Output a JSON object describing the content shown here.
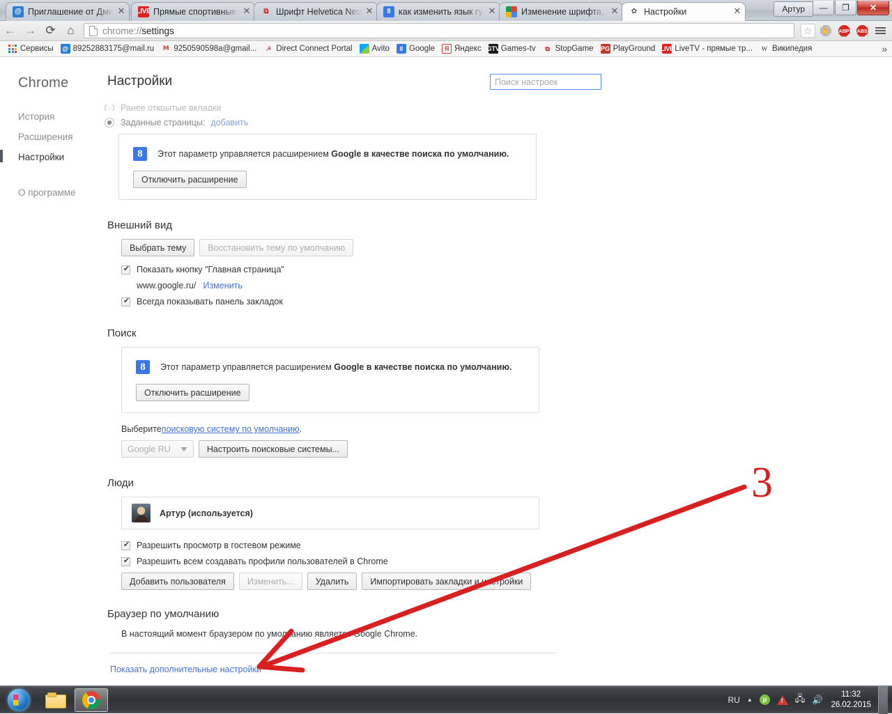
{
  "window": {
    "user_badge": "Артур",
    "controls": {
      "minimize": "—",
      "maximize": "❐",
      "close": "✕"
    }
  },
  "tabs": [
    {
      "title": "Приглашение от Дми",
      "icon": "mailru-icon",
      "close": "✕",
      "active": false
    },
    {
      "title": "Прямые спортивные",
      "icon": "live-icon",
      "close": "✕",
      "active": false
    },
    {
      "title": "Шрифт Helvetica Neue",
      "icon": "stopgame-icon",
      "close": "✕",
      "active": false
    },
    {
      "title": "как изменить язык гуг",
      "icon": "google-icon",
      "close": "✕",
      "active": false
    },
    {
      "title": "Изменение шрифта, s",
      "icon": "google-window-icon",
      "close": "✕",
      "active": false
    },
    {
      "title": "Настройки",
      "icon": "gear-icon",
      "close": "✕",
      "active": true
    }
  ],
  "toolbar": {
    "back": "←",
    "forward": "→",
    "reload": "⟳",
    "home": "⌂",
    "url_scheme": "chrome://",
    "url_path": "settings",
    "bookmark_star": "☆",
    "extensions": [
      {
        "name": "ghostery-icon",
        "label": ""
      },
      {
        "name": "adblock-plus-icon",
        "label": "ABP"
      },
      {
        "name": "adblock-super-icon",
        "label": "ABS"
      }
    ],
    "menu": "☰"
  },
  "bookmarks": {
    "items": [
      {
        "label": "Сервисы",
        "icon": "apps-icon"
      },
      {
        "label": "89252883175@mail.ru",
        "icon": "mailru-icon"
      },
      {
        "label": "9250590598a@gmail...",
        "icon": "gmail-icon"
      },
      {
        "label": "Direct Connect Portal",
        "icon": "dc-portal-icon"
      },
      {
        "label": "Avito",
        "icon": "avito-icon"
      },
      {
        "label": "Google",
        "icon": "google-icon"
      },
      {
        "label": "Яндекс",
        "icon": "yandex-icon"
      },
      {
        "label": "Games-tv",
        "icon": "games-tv-icon"
      },
      {
        "label": "StopGame",
        "icon": "stopgame-icon"
      },
      {
        "label": "PlayGround",
        "icon": "playground-icon"
      },
      {
        "label": "LiveTV - прямые тр...",
        "icon": "livetv-icon"
      },
      {
        "label": "Википедия",
        "icon": "wikipedia-icon"
      }
    ],
    "overflow": "»"
  },
  "sidebar": {
    "brand": "Chrome",
    "items": [
      {
        "label": "История",
        "active": false
      },
      {
        "label": "Расширения",
        "active": false
      },
      {
        "label": "Настройки",
        "active": true
      },
      {
        "label": "О программе",
        "active": false
      }
    ]
  },
  "page": {
    "title": "Настройки",
    "search_placeholder": "Поиск настроек",
    "search_value": "",
    "startup": {
      "clipped_option": "Ранее открытые вкладки",
      "selected_option": "Заданные страницы:",
      "add_link": "добавить"
    },
    "extension_notice": {
      "text_prefix": "Этот параметр управляется расширением ",
      "text_bold": "Google в качестве поиска по умолчанию.",
      "disable_button": "Отключить расширение",
      "icon": "google-extension-icon"
    },
    "appearance": {
      "title": "Внешний вид",
      "choose_theme": "Выбрать тему",
      "reset_theme": "Восстановить тему по умолчанию",
      "show_home_button": "Показать кнопку \"Главная страница\"",
      "show_home_button_checked": true,
      "home_url": "www.google.ru/",
      "change_link": "Изменить",
      "always_show_bookmarks": "Всегда показывать панель закладок",
      "always_show_bookmarks_checked": true
    },
    "search": {
      "title": "Поиск",
      "choose_prefix": "Выберите ",
      "choose_link": "поисковую систему по умолчанию",
      "choose_suffix": ".",
      "engine_selected": "Google RU",
      "manage_button": "Настроить поисковые системы..."
    },
    "people": {
      "title": "Люди",
      "profile_name": "Артур (используется)",
      "allow_guest": "Разрешить просмотр в гостевом режиме",
      "allow_guest_checked": true,
      "allow_create": "Разрешить всем создавать профили пользователей в Chrome",
      "allow_create_checked": true,
      "add_user": "Добавить пользователя",
      "edit_user": "Изменить...",
      "delete_user": "Удалить",
      "import": "Импортировать закладки и настройки"
    },
    "default_browser": {
      "title": "Браузер по умолчанию",
      "status": "В настоящий момент браузером по умолчанию является Google Chrome."
    },
    "advanced_link": "Показать дополнительные настройки"
  },
  "annotation": {
    "step_number": "3",
    "color": "#d82020"
  },
  "taskbar": {
    "start": "start-orb",
    "items": [
      {
        "name": "file-explorer",
        "active": false
      },
      {
        "name": "google-chrome",
        "active": true
      }
    ],
    "tray": {
      "language": "RU",
      "expand": "▲",
      "utorrent": "μ",
      "warning": "!",
      "network": "network-icon",
      "volume": "🔊"
    },
    "clock_time": "11:32",
    "clock_date": "26.02.2015"
  }
}
